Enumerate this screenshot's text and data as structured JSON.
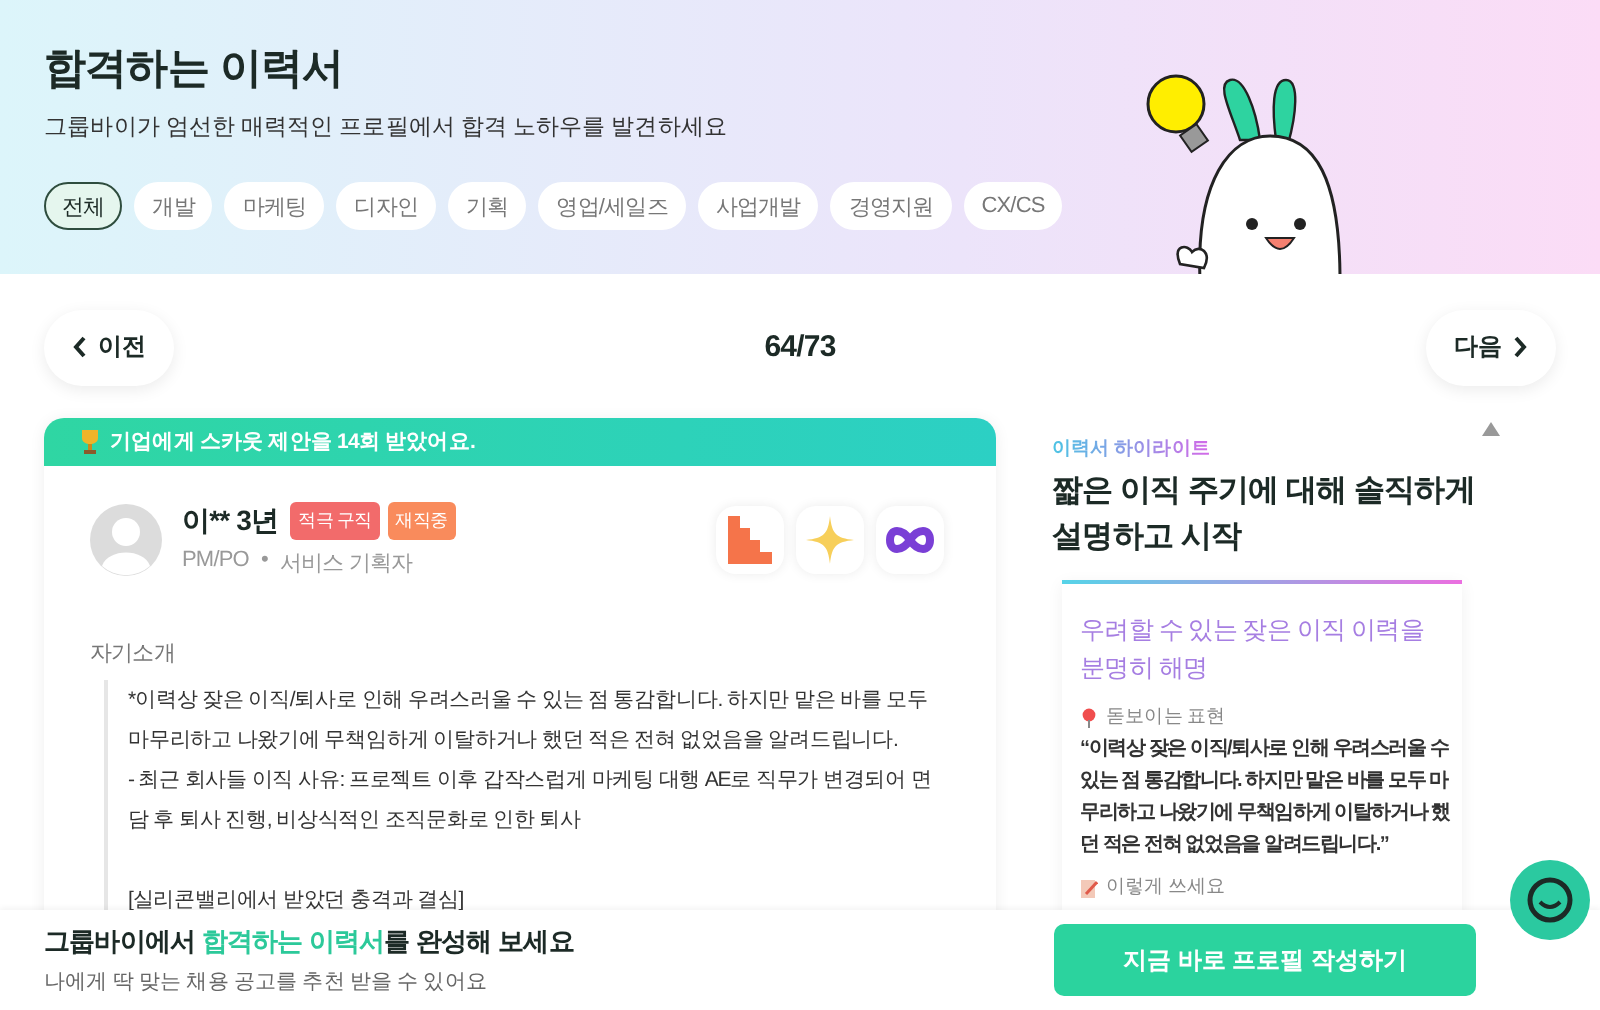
{
  "header": {
    "title": "합격하는 이력서",
    "subtitle": "그룹바이가 엄선한 매력적인 프로필에서 합격 노하우를 발견하세요",
    "categories": [
      {
        "label": "전체",
        "selected": true
      },
      {
        "label": "개발",
        "selected": false
      },
      {
        "label": "마케팅",
        "selected": false
      },
      {
        "label": "디자인",
        "selected": false
      },
      {
        "label": "기획",
        "selected": false
      },
      {
        "label": "영업/세일즈",
        "selected": false
      },
      {
        "label": "사업개발",
        "selected": false
      },
      {
        "label": "경영지원",
        "selected": false
      },
      {
        "label": "CX/CS",
        "selected": false
      }
    ]
  },
  "pager": {
    "prev": "이전",
    "counter": "64/73",
    "next": "다음"
  },
  "profile_card": {
    "banner": "기업에게 스카웃 제안을 14회 받았어요.",
    "name": "이** 3년",
    "tags": [
      {
        "label": "적극 구직",
        "color": "#f26b6b"
      },
      {
        "label": "재직중",
        "color": "#f98b5c"
      }
    ],
    "role": "PM/PO",
    "separator": "•",
    "job": "서비스 기획자",
    "section": "자기소개",
    "paragraphs": [
      [
        "*이력상 잦은 이직/퇴사로 인해 우려스러울 수 있는 점 통감합니다. 하지만 맡은 바를 모두 마무리하고 나왔기에 무책임하게 이탈하거나 했던 적은 전혀 없었음을 알려드립니다.",
        "- 최근 회사들 이직 사유: 프로젝트 이후 갑작스럽게 마케팅 대행 AE로 직무가 변경되어 면담 후 퇴사 진행, 비상식적인 조직문화로 인한 퇴사"
      ],
      [
        "[실리콘밸리에서 받았던 충격과 결심]"
      ]
    ]
  },
  "highlight": {
    "label": "이력서 하이라이트",
    "title": "짧은 이직 주기에 대해 솔직하게 설명하고 시작",
    "card": {
      "heading": "우려할 수 있는 잦은 이직 이력을 분명히 해명",
      "sections": [
        {
          "kind": "expression",
          "label": "돋보이는 표현",
          "text": "“이력상 잦은 이직/퇴사로 인해 우려스러울 수 있는 점 통감합니다. 하지만 맡은 바를 모두 마무리하고 나왔기에 무책임하게 이탈하거나 했던 적은 전혀 없었음을 알려드립니다.”"
        },
        {
          "kind": "tip",
          "label": "이렇게 쓰세요"
        }
      ]
    }
  },
  "bottom_bar": {
    "title": {
      "before": "그룹바이에서 ",
      "highlight": "합격하는 이력서",
      "after": "를 완성해 보세요"
    },
    "subtitle": "나에게 딱 맞는 채용 공고를 추천 받을 수 있어요",
    "button": "지금 바로 프로필 작성하기"
  }
}
